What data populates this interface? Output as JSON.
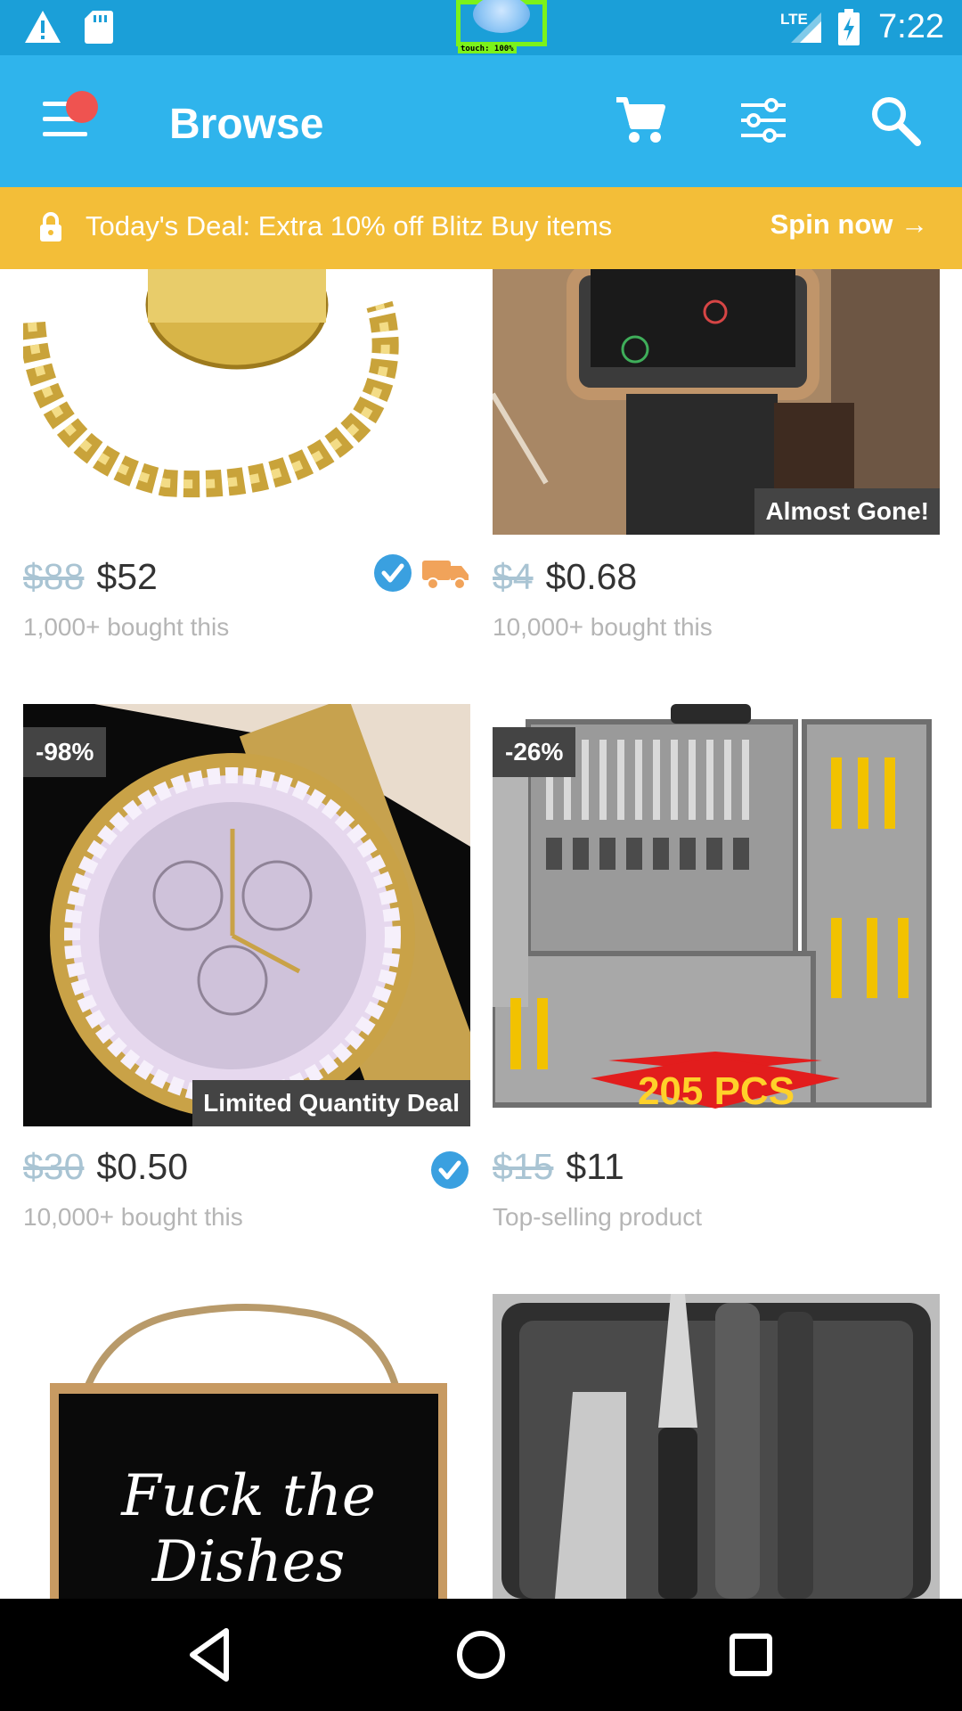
{
  "status_bar": {
    "network": "LTE",
    "time": "7:22",
    "touch_label": "touch: 100%",
    "icons": [
      "warning-icon",
      "sd-card-icon",
      "signal-icon",
      "battery-charging-icon"
    ]
  },
  "app_bar": {
    "title": "Browse",
    "icons": [
      "menu-icon",
      "cart-icon",
      "filter-icon",
      "search-icon"
    ]
  },
  "deal_banner": {
    "text": "Today's Deal: Extra 10% off Blitz Buy items",
    "cta": "Spin now →"
  },
  "products": [
    {
      "old_price": "$88",
      "price": "$52",
      "subtitle": "1,000+ bought this",
      "verified": true,
      "fast_shipping": true
    },
    {
      "old_price": "$4",
      "price": "$0.68",
      "subtitle": "10,000+ bought this",
      "tag": "Almost Gone!"
    },
    {
      "discount": "-98%",
      "tag": "Limited Quantity Deal",
      "old_price": "$30",
      "price": "$0.50",
      "subtitle": "10,000+ bought this",
      "verified": true
    },
    {
      "discount": "-26%",
      "old_price": "$15",
      "price": "$11",
      "subtitle": "Top-selling product",
      "image_caption": "205 PCS"
    },
    {
      "sign_text": "Fuck the Dishes"
    },
    {}
  ],
  "colors": {
    "status_bar": "#1b9fd8",
    "app_bar": "#2fb4ec",
    "deal_banner": "#f3be38",
    "old_price": "#a9c4d3",
    "verified_badge": "#3aa0e0",
    "shipping": "#f1a35a"
  }
}
